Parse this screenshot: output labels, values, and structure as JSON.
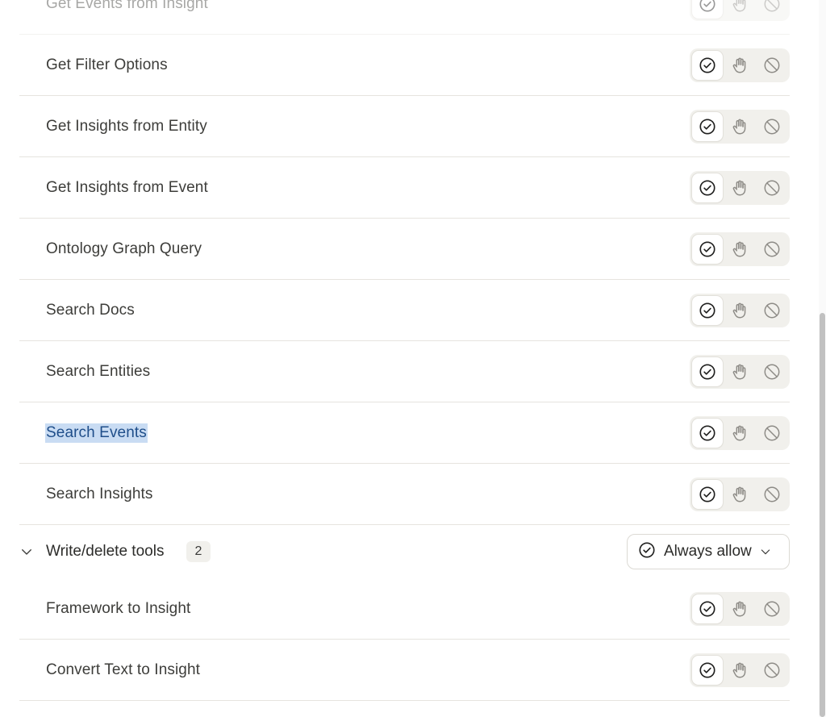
{
  "tools_top": [
    {
      "label": "Get Events from Insight",
      "faded": true,
      "selected": false
    },
    {
      "label": "Get Filter Options",
      "faded": false,
      "selected": false
    },
    {
      "label": "Get Insights from Entity",
      "faded": false,
      "selected": false
    },
    {
      "label": "Get Insights from Event",
      "faded": false,
      "selected": false
    },
    {
      "label": "Ontology Graph Query",
      "faded": false,
      "selected": false
    },
    {
      "label": "Search Docs",
      "faded": false,
      "selected": false
    },
    {
      "label": "Search Entities",
      "faded": false,
      "selected": false
    },
    {
      "label": "Search Events",
      "faded": false,
      "selected": true
    },
    {
      "label": "Search Insights",
      "faded": false,
      "selected": false
    }
  ],
  "section": {
    "title": "Write/delete tools",
    "count": "2",
    "dropdown_label": "Always allow",
    "icons": {
      "chevron": "chevron-down-icon",
      "status": "check-circle-icon"
    }
  },
  "tools_bottom": [
    {
      "label": "Framework to Insight",
      "faded": false,
      "selected": false
    },
    {
      "label": "Convert Text to Insight",
      "faded": false,
      "selected": false
    }
  ],
  "permission_icons": [
    "check-circle-icon",
    "hand-icon",
    "block-icon"
  ],
  "colors": {
    "selection_bg": "#c9dcf3",
    "segment_bg": "#f1f0ec",
    "divider": "#e6e4df"
  }
}
